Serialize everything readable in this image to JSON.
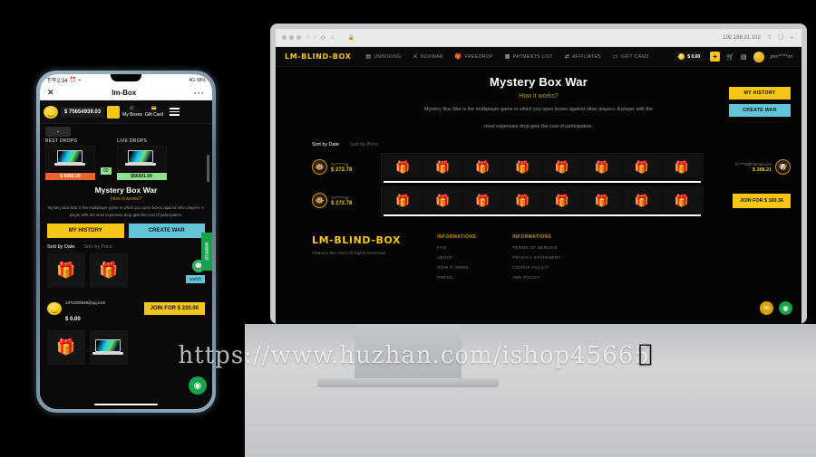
{
  "watermark": {
    "url": "https://www.huzhan.com/ishop45665",
    "apple_icon": "apple-logo"
  },
  "phone": {
    "status": {
      "time": "下午2:34",
      "left_icons": "alarm-icon wifi-icon",
      "signal": "4G",
      "battery": "68%"
    },
    "titlebar": {
      "close": "✕",
      "title": "lm-Box",
      "menu": "···"
    },
    "nav": {
      "balance": "$ 75654939.03",
      "plus": "+",
      "my_boxes": "My Boxes",
      "gift_card": "Gift Card",
      "menu_icon": "hamburger-icon"
    },
    "tabs": {
      "best_drops": "BEST DROPS",
      "live_drops": "LIVE DROPS"
    },
    "drops": [
      {
        "price": "$ 5060.00",
        "style": "orange"
      },
      {
        "price": "00",
        "style": "green-small"
      },
      {
        "price": "$56501.00",
        "style": "green"
      }
    ],
    "hero": {
      "title": "Mystery Box War",
      "how": "How it works?",
      "desc": "Mystery Box War is the multiplayer game in which you open boxes against other players. A player with the most expensive drop gets the cost of participation.",
      "btn_history": "MY HISTORY",
      "btn_create": "CREATE WAR"
    },
    "sorts": {
      "date": "Sort by Date",
      "price": "Sort by Price"
    },
    "war": {
      "watch": "watch",
      "username": "2371000839@qq.com",
      "amount": "$ 0.00",
      "join": "JOIN FOR $ 220.00"
    },
    "side_tab": "客服咨询",
    "fab_chat": "chat-icon",
    "fab_main": "support-icon"
  },
  "browser": {
    "url": "192.168.31.102",
    "reload": "⟳",
    "traffic_lights": "window-controls",
    "back": "‹",
    "forward": "›",
    "refresh": "⟳",
    "home": "⌂",
    "right_icons": "share-icon tabs-icon plus-icon"
  },
  "site": {
    "logo": "LM-BLIND-BOX",
    "nav_items": [
      {
        "icon": "box-icon",
        "label": "UNBOXING"
      },
      {
        "icon": "swords-icon",
        "label": "BOXWAR"
      },
      {
        "icon": "gift-icon",
        "label": "FREEDROP"
      },
      {
        "icon": "wallet-icon",
        "label": "PAYMENTS LIST"
      },
      {
        "icon": "share-icon",
        "label": "AFFILIATES"
      },
      {
        "icon": "card-icon",
        "label": "GIFT CARD"
      }
    ],
    "user": {
      "balance": "$ 0.00",
      "plus": "+",
      "cart_icon": "cart-icon",
      "inventory_icon": "inventory-icon",
      "avatar": "user-avatar",
      "username": "pwn*****on"
    },
    "hero": {
      "title": "Mystery Box War",
      "how": "How it works?",
      "desc_line1": "Mystery Box War is the multiplayer game in which you open boxes against other players. A player with the",
      "desc_line2": "most expensive drop gets the cost of participation.",
      "btn_history": "MY HISTORY",
      "btn_create": "CREATE WAR"
    },
    "sorts": {
      "date": "Sort by Date",
      "price": "Sort by Price"
    },
    "wars": [
      {
        "left": {
          "avatar": "player-avatar",
          "name": "Yu******ng",
          "value": "$ 272.78"
        },
        "boxes": [
          "🎁",
          "🎁",
          "🎁",
          "🎁",
          "🎁",
          "🎁",
          "🎁",
          "🎁"
        ],
        "right": {
          "name": "K*****s@hotmail.com",
          "value": "$ 288.21",
          "avatar": "player-avatar",
          "has_join": false
        }
      },
      {
        "left": {
          "avatar": "player-avatar",
          "name": "Yu******ng",
          "value": "$ 272.78"
        },
        "boxes": [
          "🎁",
          "🎁",
          "🎁",
          "🎁",
          "🎁",
          "🎁",
          "🎁",
          "🎁"
        ],
        "right": {
          "join": "JOIN FOR $ 160.36",
          "has_join": true
        }
      }
    ],
    "footer": {
      "logo": "LM-BLIND-BOX",
      "copyright": "©Demo1-Box 2022 All Rights Reserved",
      "col1": {
        "title": "INFORMATIONS",
        "links": [
          "FAQ",
          "ABOUT",
          "HOW IT WORK",
          "PRESS"
        ]
      },
      "col2": {
        "title": "INFORMATIONS",
        "links": [
          "TERMS OF SERVICE",
          "PRIVACY STATEMENT",
          "COOKIE POLICY",
          "AML POLICY"
        ]
      }
    },
    "fabs": {
      "mail": "mail-icon",
      "support": "support-icon"
    }
  },
  "colors": {
    "accent": "#f5c518",
    "cyan": "#63c4d8",
    "bg": "#050505",
    "green": "#16a34a"
  }
}
